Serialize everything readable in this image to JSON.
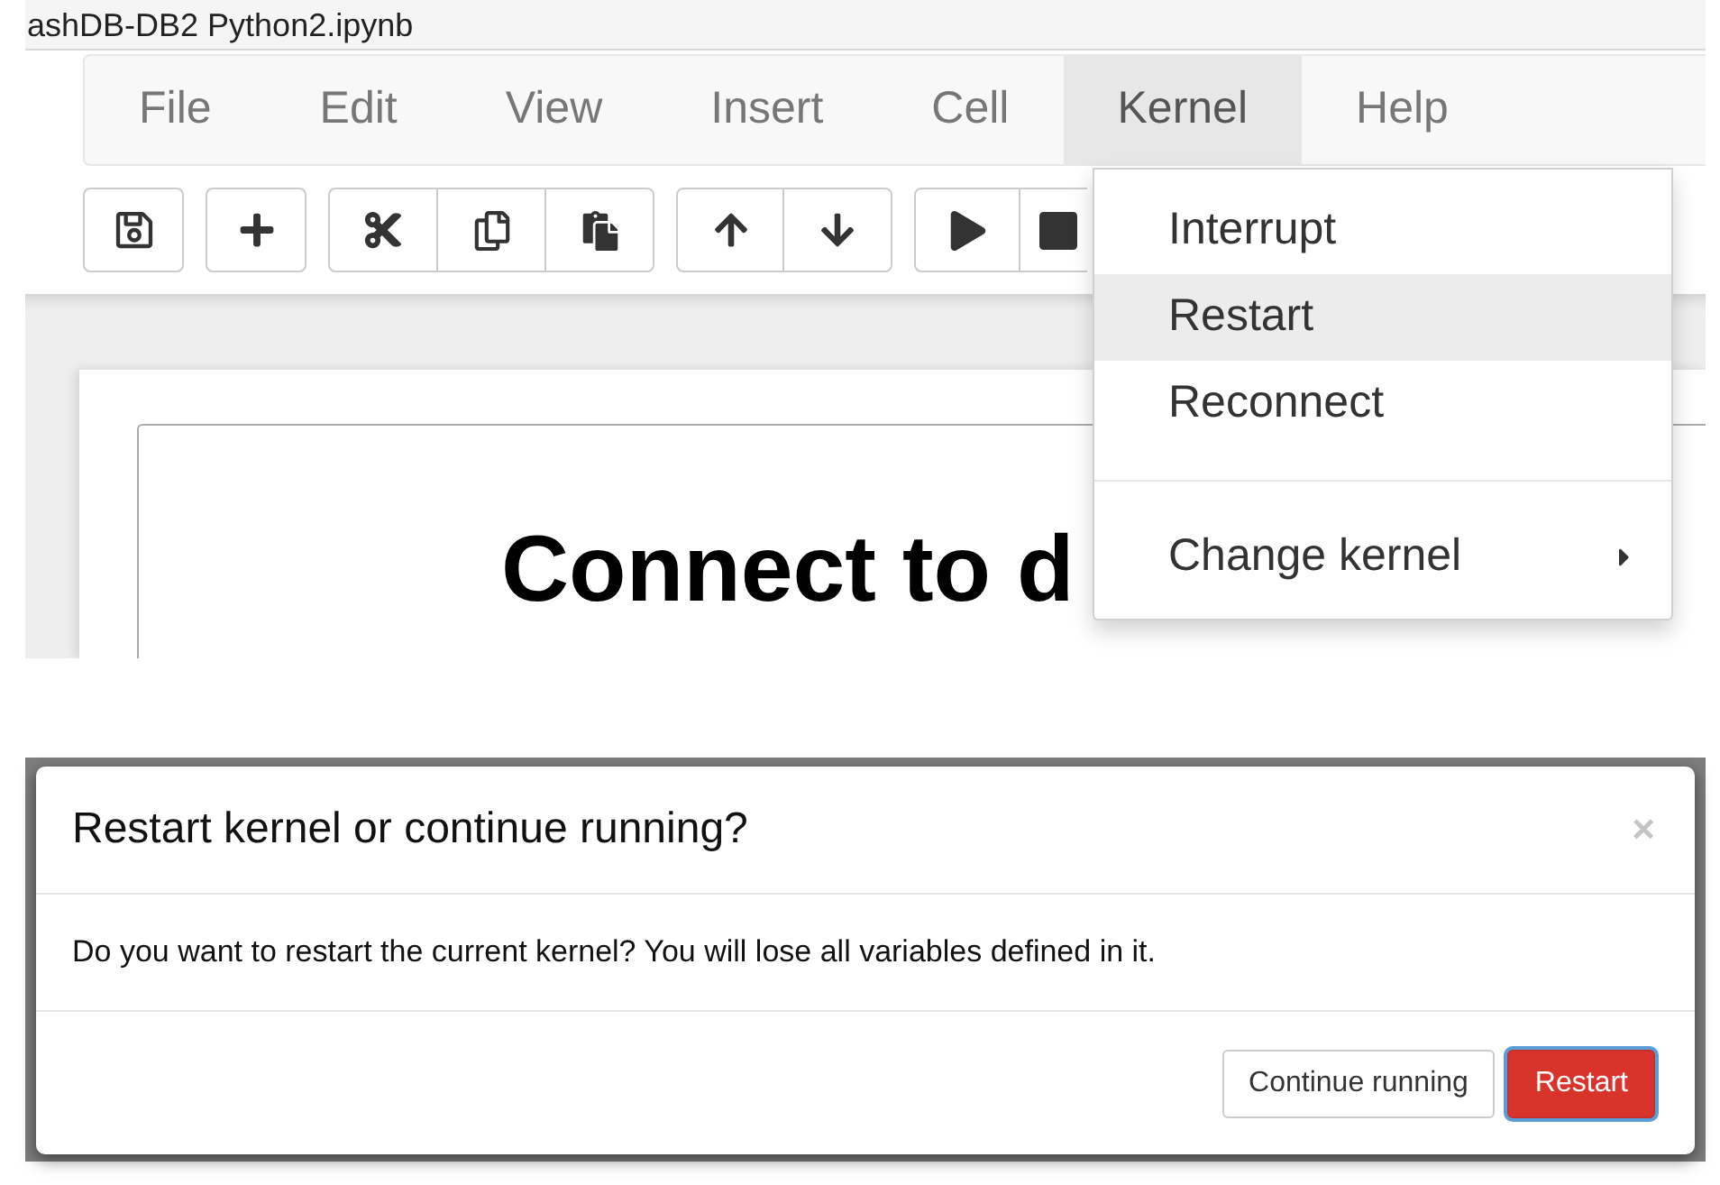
{
  "notebook_window": {
    "title": "ashDB-DB2 Python2.ipynb",
    "menu_bar": [
      {
        "label": "File",
        "selected": false
      },
      {
        "label": "Edit",
        "selected": false
      },
      {
        "label": "View",
        "selected": false
      },
      {
        "label": "Insert",
        "selected": false
      },
      {
        "label": "Cell",
        "selected": false
      },
      {
        "label": "Kernel",
        "selected": true
      },
      {
        "label": "Help",
        "selected": false
      }
    ],
    "cell_heading": "Connect to d",
    "kernel_menu": {
      "items": [
        {
          "kind": "item",
          "label": "Interrupt",
          "selected": false
        },
        {
          "kind": "item",
          "label": "Restart",
          "selected": true
        },
        {
          "kind": "item",
          "label": "Reconnect",
          "selected": false
        },
        {
          "kind": "divider"
        },
        {
          "kind": "submenu",
          "label": "Change kernel",
          "selected": false
        }
      ]
    }
  },
  "restart_dialog": {
    "title": "Restart kernel or continue running?",
    "close": "×",
    "message": "Do you want to restart the current kernel? You will lose all variables defined in it.",
    "buttons": [
      {
        "kind": "default",
        "label": "Continue running",
        "focused": false
      },
      {
        "kind": "danger",
        "label": "Restart",
        "focused": true
      }
    ]
  }
}
